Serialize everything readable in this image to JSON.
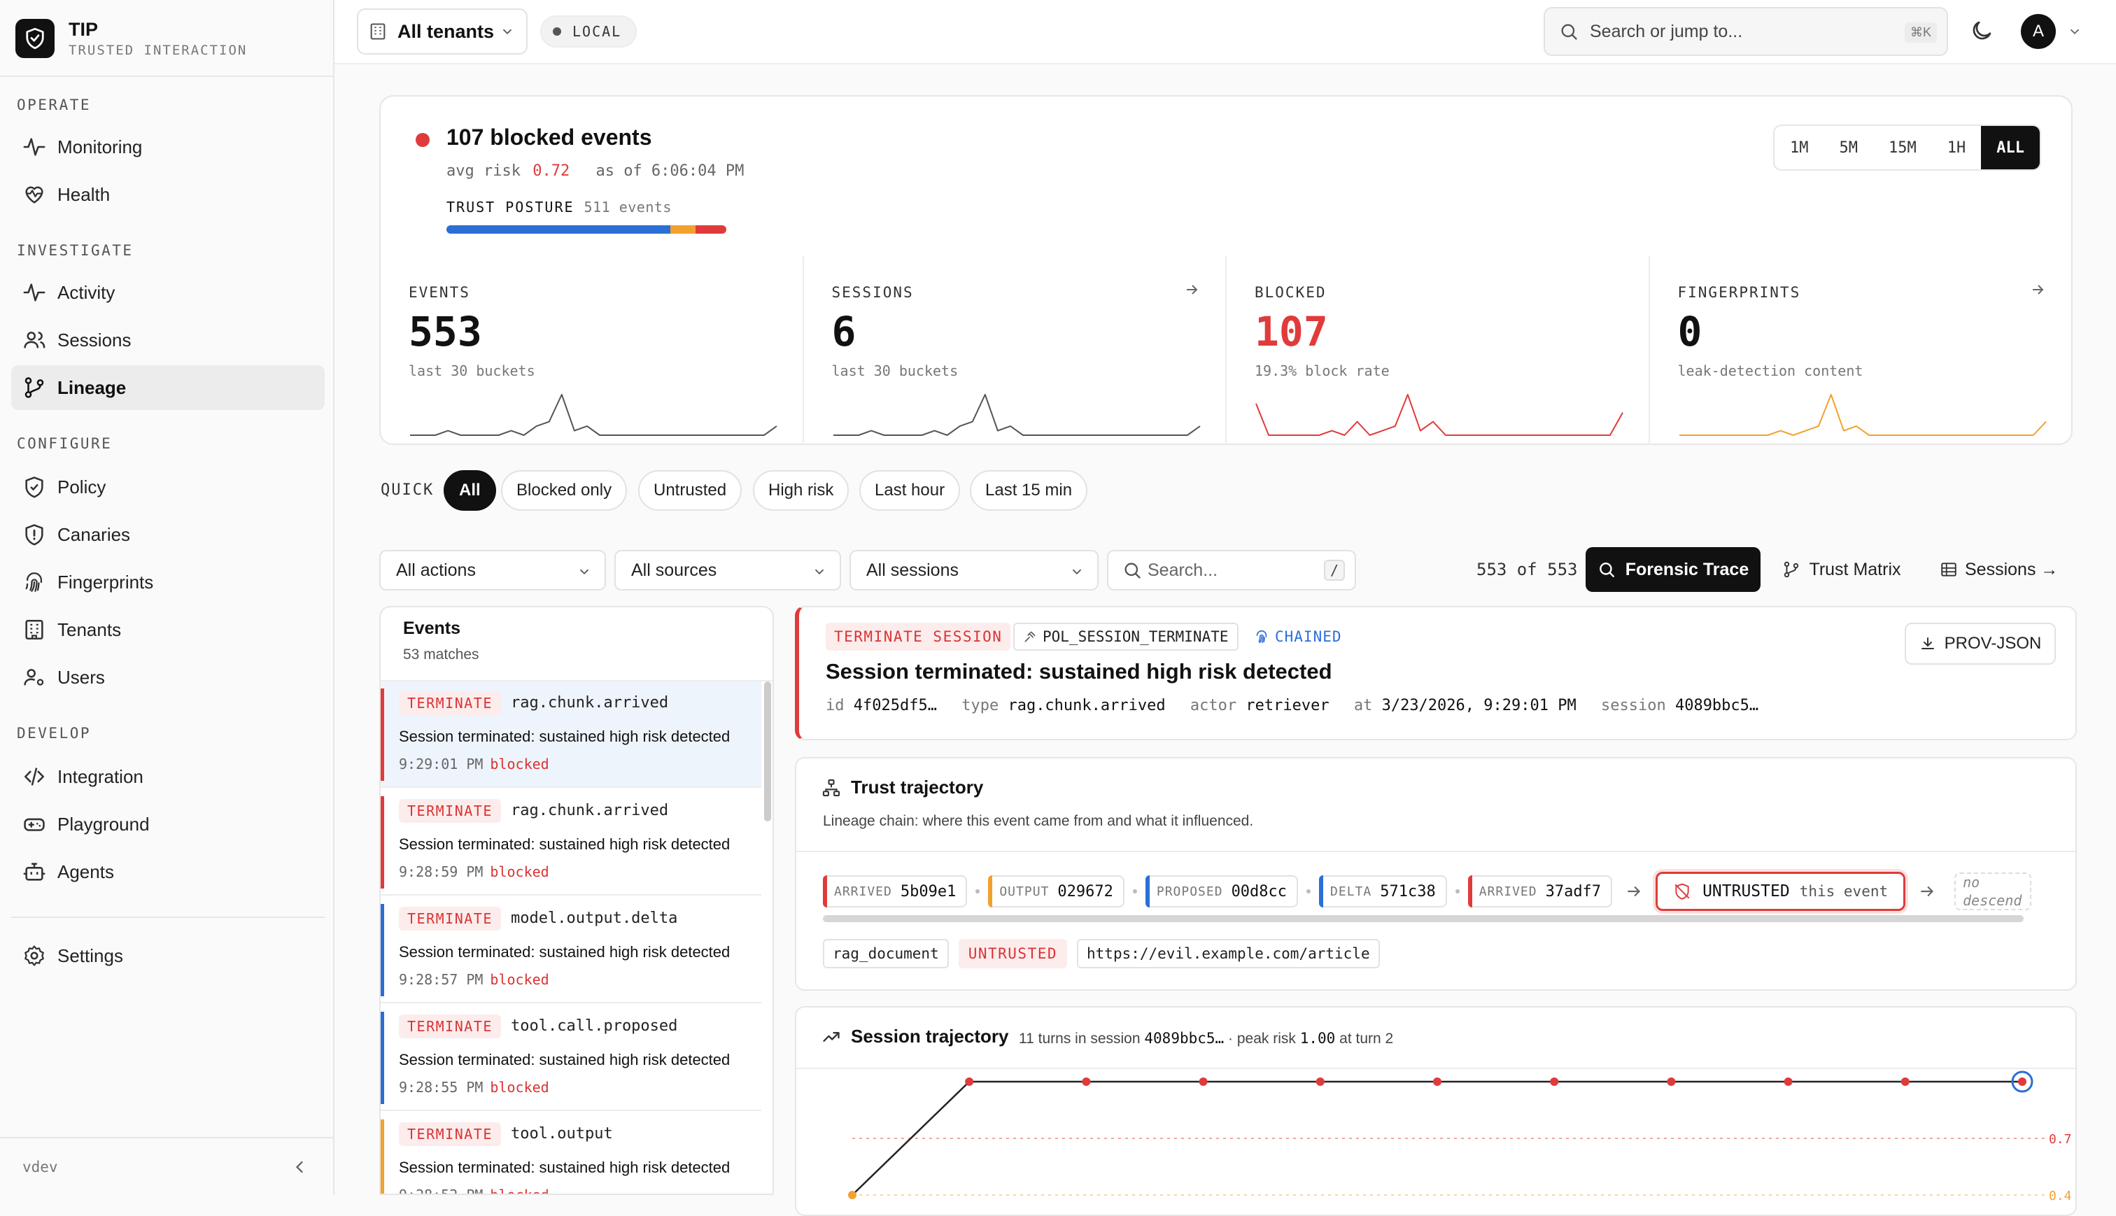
{
  "brand": {
    "title": "TIP",
    "subtitle": "TRUSTED INTERACTION"
  },
  "sidebar": {
    "sections": [
      {
        "label": "OPERATE",
        "items": [
          {
            "label": "Monitoring",
            "icon": "activity-icon"
          },
          {
            "label": "Health",
            "icon": "heart-pulse-icon"
          }
        ]
      },
      {
        "label": "INVESTIGATE",
        "items": [
          {
            "label": "Activity",
            "icon": "activity-icon"
          },
          {
            "label": "Sessions",
            "icon": "users-icon"
          },
          {
            "label": "Lineage",
            "icon": "git-branch-icon",
            "active": true
          }
        ]
      },
      {
        "label": "CONFIGURE",
        "items": [
          {
            "label": "Policy",
            "icon": "shield-check-icon"
          },
          {
            "label": "Canaries",
            "icon": "shield-alert-icon"
          },
          {
            "label": "Fingerprints",
            "icon": "fingerprint-icon"
          },
          {
            "label": "Tenants",
            "icon": "building-icon"
          },
          {
            "label": "Users",
            "icon": "user-cog-icon"
          }
        ]
      },
      {
        "label": "DEVELOP",
        "items": [
          {
            "label": "Integration",
            "icon": "code-icon"
          },
          {
            "label": "Playground",
            "icon": "gamepad-icon"
          },
          {
            "label": "Agents",
            "icon": "bot-icon"
          }
        ]
      }
    ],
    "settings": "Settings",
    "version": "vdev"
  },
  "topbar": {
    "tenant": "All tenants",
    "env": "LOCAL",
    "search_placeholder": "Search or jump to...",
    "search_kbd": "⌘K",
    "avatar": "A"
  },
  "summary": {
    "title": "107 blocked events",
    "avg_risk_label": "avg risk",
    "avg_risk": "0.72",
    "as_of": "as of 6:06:04 PM",
    "posture_label": "TRUST POSTURE",
    "posture_events": "511 events",
    "posture_split": {
      "trusted": 0.8,
      "untrusted": 0.09,
      "blocked": 0.11
    },
    "ranges": [
      "1M",
      "5M",
      "15M",
      "1H",
      "ALL"
    ],
    "active_range": "ALL",
    "stats": [
      {
        "label": "EVENTS",
        "value": "553",
        "sub": "last 30 buckets",
        "color": "#555555",
        "arrow": false,
        "spark": [
          0,
          0,
          0,
          1,
          0,
          0,
          0,
          0,
          1,
          0,
          2,
          3,
          9,
          1,
          2,
          0,
          0,
          0,
          0,
          0,
          0,
          0,
          0,
          0,
          0,
          0,
          0,
          0,
          0,
          2
        ]
      },
      {
        "label": "SESSIONS",
        "value": "6",
        "sub": "last 30 buckets",
        "color": "#555555",
        "arrow": true,
        "spark": [
          0,
          0,
          0,
          1,
          0,
          0,
          0,
          0,
          1,
          0,
          2,
          3,
          9,
          1,
          2,
          0,
          0,
          0,
          0,
          0,
          0,
          0,
          0,
          0,
          0,
          0,
          0,
          0,
          0,
          2
        ]
      },
      {
        "label": "BLOCKED",
        "value": "107",
        "sub": "19.3% block rate",
        "color": "#e03b3b",
        "arrow": false,
        "spark": [
          7,
          0,
          0,
          0,
          0,
          0,
          1,
          0,
          3,
          0,
          1,
          2,
          9,
          1,
          3,
          0,
          0,
          0,
          0,
          0,
          0,
          0,
          0,
          0,
          0,
          0,
          0,
          0,
          0,
          5
        ]
      },
      {
        "label": "FINGERPRINTS",
        "value": "0",
        "sub": "leak-detection content",
        "color": "#f2a12e",
        "arrow": true,
        "spark": [
          0,
          0,
          0,
          0,
          0,
          0,
          0,
          0,
          1,
          0,
          1,
          2,
          9,
          1,
          2,
          0,
          0,
          0,
          0,
          0,
          0,
          0,
          0,
          0,
          0,
          0,
          0,
          0,
          0,
          3
        ]
      }
    ]
  },
  "quick": {
    "label": "QUICK",
    "chips": [
      "All",
      "Blocked only",
      "Untrusted",
      "High risk",
      "Last hour",
      "Last 15 min"
    ],
    "active": "All"
  },
  "filters": {
    "actions": "All actions",
    "sources": "All sources",
    "sessions": "All sessions",
    "search_placeholder": "Search...",
    "search_kbd": "/",
    "count": "553 of 553",
    "forensic": "Forensic Trace",
    "trust_matrix": "Trust Matrix",
    "sessions_link": "Sessions →"
  },
  "events": {
    "title": "Events",
    "count": "53 matches",
    "items": [
      {
        "badge": "TERMINATE",
        "type": "rag.chunk.arrived",
        "msg": "Session terminated: sustained high risk detected",
        "time": "9:29:01 PM",
        "status": "blocked",
        "color": "#e03b3b"
      },
      {
        "badge": "TERMINATE",
        "type": "rag.chunk.arrived",
        "msg": "Session terminated: sustained high risk detected",
        "time": "9:28:59 PM",
        "status": "blocked",
        "color": "#e03b3b"
      },
      {
        "badge": "TERMINATE",
        "type": "model.output.delta",
        "msg": "Session terminated: sustained high risk detected",
        "time": "9:28:57 PM",
        "status": "blocked",
        "color": "#2b6fd6"
      },
      {
        "badge": "TERMINATE",
        "type": "tool.call.proposed",
        "msg": "Session terminated: sustained high risk detected",
        "time": "9:28:55 PM",
        "status": "blocked",
        "color": "#2b6fd6"
      },
      {
        "badge": "TERMINATE",
        "type": "tool.output",
        "msg": "Session terminated: sustained high risk detected",
        "time": "9:28:52 PM",
        "status": "blocked",
        "color": "#f2a12e"
      }
    ]
  },
  "detail": {
    "badge": "TERMINATE SESSION",
    "policy": "POL_SESSION_TERMINATE",
    "chained": "CHAINED",
    "prov": "PROV-JSON",
    "title": "Session terminated: sustained high risk detected",
    "meta": [
      {
        "k": "id",
        "v": "4f025df5…"
      },
      {
        "k": "type",
        "v": "rag.chunk.arrived"
      },
      {
        "k": "actor",
        "v": "retriever"
      },
      {
        "k": "at",
        "v": "3/23/2026, 9:29:01 PM"
      },
      {
        "k": "session",
        "v": "4089bbc5…"
      }
    ]
  },
  "trust": {
    "title": "Trust trajectory",
    "sub": "Lineage chain: where this event came from and what it influenced.",
    "nodes": [
      {
        "kind": "ARRIVED",
        "id": "5b09e1",
        "color": "#e03b3b"
      },
      {
        "kind": "OUTPUT",
        "id": "029672",
        "color": "#f2a12e"
      },
      {
        "kind": "PROPOSED",
        "id": "00d8cc",
        "color": "#2b6fd6"
      },
      {
        "kind": "DELTA",
        "id": "571c38",
        "color": "#2b6fd6"
      },
      {
        "kind": "ARRIVED",
        "id": "37adf7",
        "color": "#e03b3b"
      }
    ],
    "current": {
      "label": "UNTRUSTED",
      "suffix": "this event"
    },
    "no_descend": [
      "no",
      "descend"
    ],
    "tags": [
      "rag_document",
      "UNTRUSTED",
      "https://evil.example.com/article"
    ]
  },
  "session": {
    "title": "Session trajectory",
    "sub_prefix": "11 turns in session",
    "session_id": "4089bbc5…",
    "sub_mid": "· peak risk",
    "peak": "1.00",
    "sub_suffix": "at turn 2",
    "tick_labels": [
      "0.7",
      "0.4"
    ]
  },
  "chart_data": {
    "type": "line",
    "title": "Session trajectory",
    "x": [
      1,
      2,
      3,
      4,
      5,
      6,
      7,
      8,
      9,
      10,
      11
    ],
    "series": [
      {
        "values": [
          0.4,
          1.0,
          1.0,
          1.0,
          1.0,
          1.0,
          1.0,
          1.0,
          1.0,
          1.0,
          1.0
        ]
      }
    ],
    "thresholds": [
      0.7,
      0.4
    ],
    "ylim": [
      0.4,
      1.0
    ]
  }
}
